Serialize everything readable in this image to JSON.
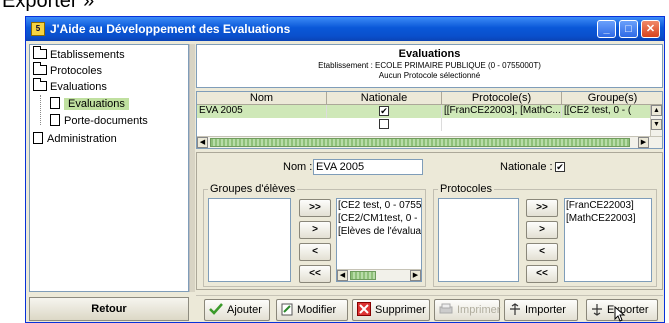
{
  "caption": "Exporter »",
  "window": {
    "title": "J'Aide au Développement des Evaluations",
    "controls": {
      "minimize": "_",
      "maximize": "□",
      "close": "✕"
    }
  },
  "sidebar": {
    "items": [
      {
        "label": "Etablissements",
        "icon": "folder-icon"
      },
      {
        "label": "Protocoles",
        "icon": "folder-icon"
      },
      {
        "label": "Evaluations",
        "icon": "folder-icon"
      },
      {
        "label": "Evaluations",
        "icon": "document-icon",
        "selected": true
      },
      {
        "label": "Porte-documents",
        "icon": "document-icon"
      },
      {
        "label": "Administration",
        "icon": "document-icon"
      }
    ],
    "back_button": "Retour"
  },
  "header": {
    "title": "Evaluations",
    "school": "Etablissement : ECOLE PRIMAIRE PUBLIQUE  (0 - 0755000T)",
    "protocol_status": "Aucun Protocole sélectionné"
  },
  "grid": {
    "columns": [
      "Nom",
      "Nationale",
      "Protocole(s)",
      "Groupe(s)"
    ],
    "rows": [
      {
        "nom": "EVA 2005",
        "nationale": true,
        "protocoles": "[[FranCE22003], [MathC...",
        "groupes": "[[CE2 test, 0 - ("
      }
    ]
  },
  "details": {
    "nom_label": "Nom :",
    "nom_value": "EVA 2005",
    "nationale_label": "Nationale :",
    "nationale_checked": true,
    "groupes_legend": "Groupes d'élèves",
    "groupes_selected": [
      "[CE2 test, 0 - 0755",
      "[CE2/CM1test, 0 -",
      "[Elèves de l'évalua"
    ],
    "protocoles_legend": "Protocoles",
    "protocoles_selected": [
      "[FranCE22003]",
      "[MathCE22003]"
    ],
    "move_buttons": [
      ">>",
      ">",
      "<",
      "<<"
    ]
  },
  "toolbar": {
    "ajouter": "Ajouter",
    "modifier": "Modifier",
    "supprimer": "Supprimer",
    "imprimer": "Imprimer",
    "importer": "Importer",
    "exporter": "Exporter"
  },
  "colors": {
    "titlebar": "#0a58d8",
    "selection": "#cfe8b8",
    "window_bg": "#ece9d8"
  }
}
